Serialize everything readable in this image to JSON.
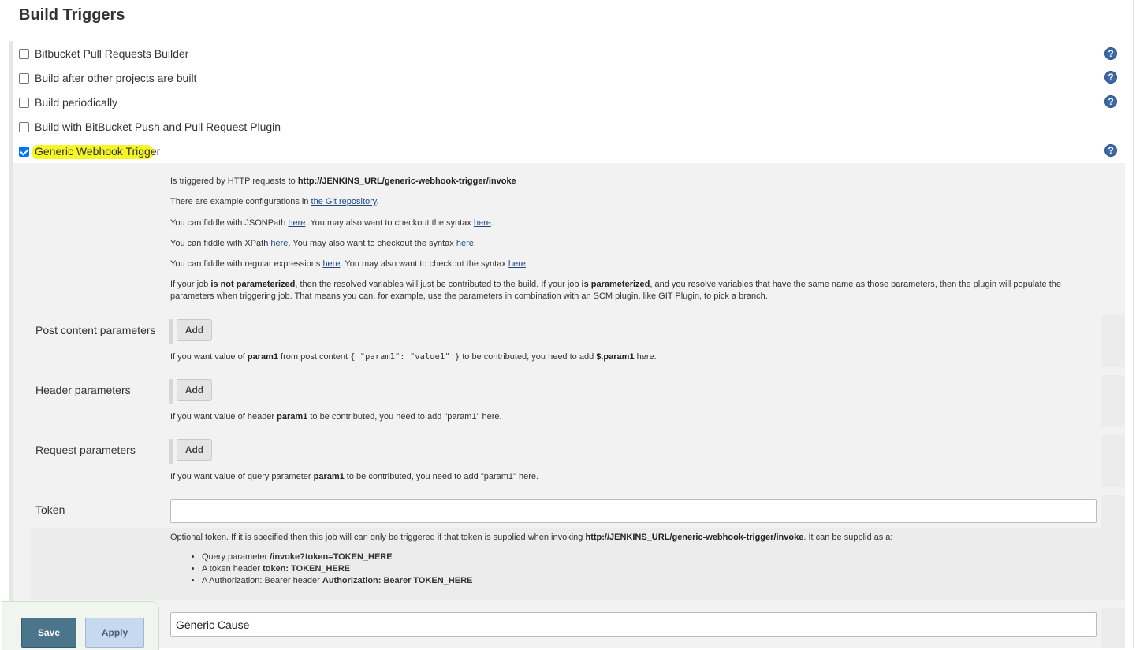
{
  "section": {
    "title": "Build Triggers"
  },
  "triggers": [
    {
      "label": "Bitbucket Pull Requests Builder",
      "checked": false,
      "help": true
    },
    {
      "label": "Build after other projects are built",
      "checked": false,
      "help": true
    },
    {
      "label": "Build periodically",
      "checked": false,
      "help": true
    },
    {
      "label": "Build with BitBucket Push and Pull Request Plugin",
      "checked": false,
      "help": false
    },
    {
      "label": "Generic Webhook Trigger",
      "checked": true,
      "help": true,
      "highlighted": true
    }
  ],
  "help_glyph": "?",
  "generic": {
    "intro": {
      "pre": "Is triggered by HTTP requests to ",
      "url": "http://JENKINS_URL/generic-webhook-trigger/invoke"
    },
    "examples": {
      "pre": "There are example configurations in ",
      "link": "the Git repository",
      "post": "."
    },
    "jsonpath": {
      "pre": "You can fiddle with JSONPath ",
      "link1": "here",
      "mid": ". You may also want to checkout the syntax ",
      "link2": "here",
      "post": "."
    },
    "xpath": {
      "pre": "You can fiddle with XPath ",
      "link1": "here",
      "mid": ". You may also want to checkout the syntax ",
      "link2": "here",
      "post": "."
    },
    "regex": {
      "pre": "You can fiddle with regular expressions ",
      "link1": "here",
      "mid": ". You may also want to checkout the syntax ",
      "link2": "here",
      "post": "."
    },
    "param_note": {
      "p1": "If your job ",
      "b1": "is not parameterized",
      "p2": ", then the resolved variables will just be contributed to the build. If your job ",
      "b2": "is parameterized",
      "p3": ", and you resolve variables that have the same name as those parameters, then the plugin will populate the parameters when triggering job. That means you can, for example, use the parameters in combination with an SCM plugin, like GIT Plugin, to pick a branch."
    },
    "post_content": {
      "label": "Post content parameters",
      "add": "Add",
      "h1": "If you want value of ",
      "hb1": "param1",
      "h2": " from post content ",
      "code": "{ \"param1\": \"value1\" }",
      "h3": " to be contributed, you need to add ",
      "hb2": "$.param1",
      "h4": " here."
    },
    "header": {
      "label": "Header parameters",
      "add": "Add",
      "h1": "If you want value of header ",
      "hb1": "param1",
      "h2": " to be contributed, you need to add \"param1\" here."
    },
    "request": {
      "label": "Request parameters",
      "add": "Add",
      "h1": "If you want value of query parameter ",
      "hb1": "param1",
      "h2": " to be contributed, you need to add \"param1\" here."
    },
    "token": {
      "label": "Token",
      "value": "",
      "h1": "Optional token. If it is specified then this job will can only be triggered if that token is supplied when invoking ",
      "hb1": "http://JENKINS_URL/generic-webhook-trigger/invoke",
      "h2": ". It can be supplid as a:",
      "items": [
        {
          "pre": "Query parameter ",
          "bold": "/invoke?token=TOKEN_HERE"
        },
        {
          "pre": "A token header ",
          "bold": "token: TOKEN_HERE"
        },
        {
          "pre": "A Authorization: Bearer header ",
          "bold": "Authorization: Bearer TOKEN_HERE"
        }
      ]
    },
    "cause": {
      "value": "Generic Cause"
    }
  },
  "actions": {
    "save": "Save",
    "apply": "Apply"
  },
  "colors": {
    "highlight": "#f4f500",
    "save_bg": "#4b758b",
    "apply_bg": "#c7d9ef",
    "help_icon": "#3d68a3",
    "checkbox_checked": "#0075ff"
  }
}
